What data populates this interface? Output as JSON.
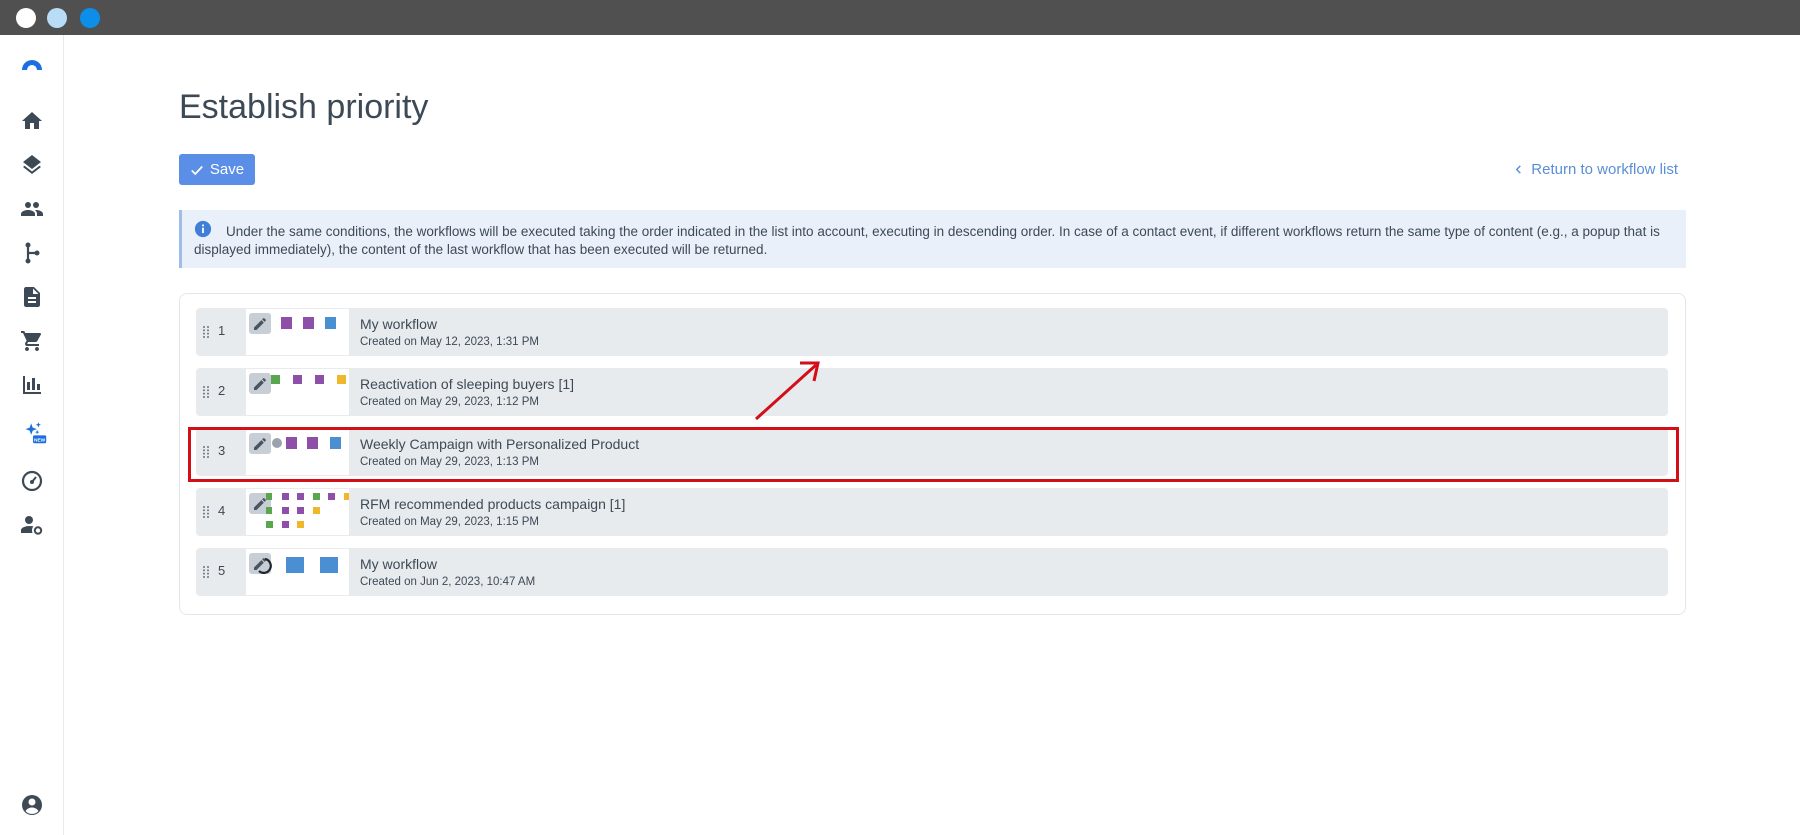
{
  "window": {
    "controls": [
      {
        "name": "close-dot",
        "color": "#ffffff"
      },
      {
        "name": "minimize-dot",
        "color": "#b9ddf7"
      },
      {
        "name": "maximize-dot",
        "color": "#0d8ee8"
      }
    ]
  },
  "sidebar": {
    "logo": "app-logo",
    "new_badge": "NEW",
    "items": [
      {
        "icon": "home-icon"
      },
      {
        "icon": "layers-icon"
      },
      {
        "icon": "people-icon"
      },
      {
        "icon": "workflow-icon"
      },
      {
        "icon": "document-icon"
      },
      {
        "icon": "cart-icon"
      },
      {
        "icon": "chart-icon"
      },
      {
        "icon": "ai-sparkles-icon"
      },
      {
        "icon": "gauge-icon"
      },
      {
        "icon": "user-settings-icon"
      }
    ],
    "bottom_icon": "account-icon"
  },
  "page": {
    "title": "Establish priority",
    "save_label": "Save",
    "return_label": "Return to workflow list",
    "info_text": "Under the same conditions, the workflows will be executed taking the order indicated in the list into account, executing in descending order. In case of a contact event, if different workflows return the same type of content (e.g., a popup that is displayed immediately), the content of the last workflow that has been executed will be returned."
  },
  "workflows": [
    {
      "order": "1",
      "name": "My workflow",
      "created": "Created on May 12, 2023, 1:31 PM",
      "highlighted": false
    },
    {
      "order": "2",
      "name": "Reactivation of sleeping buyers [1]",
      "created": "Created on May 29, 2023, 1:12 PM",
      "highlighted": false
    },
    {
      "order": "3",
      "name": "Weekly Campaign with Personalized Product",
      "created": "Created on May 29, 2023, 1:13 PM",
      "highlighted": true
    },
    {
      "order": "4",
      "name": "RFM recommended products campaign [1]",
      "created": "Created on May 29, 2023, 1:15 PM",
      "highlighted": false
    },
    {
      "order": "5",
      "name": "My workflow",
      "created": "Created on Jun 2, 2023, 10:47 AM",
      "highlighted": false
    }
  ],
  "colors": {
    "accent": "#5b8ee6",
    "link": "#5a8fd6",
    "highlight": "#d20f17",
    "node_purple": "#8e4fa8",
    "node_blue": "#4a8fd1",
    "node_green": "#5aa64e",
    "node_yellow": "#f0b62c"
  }
}
